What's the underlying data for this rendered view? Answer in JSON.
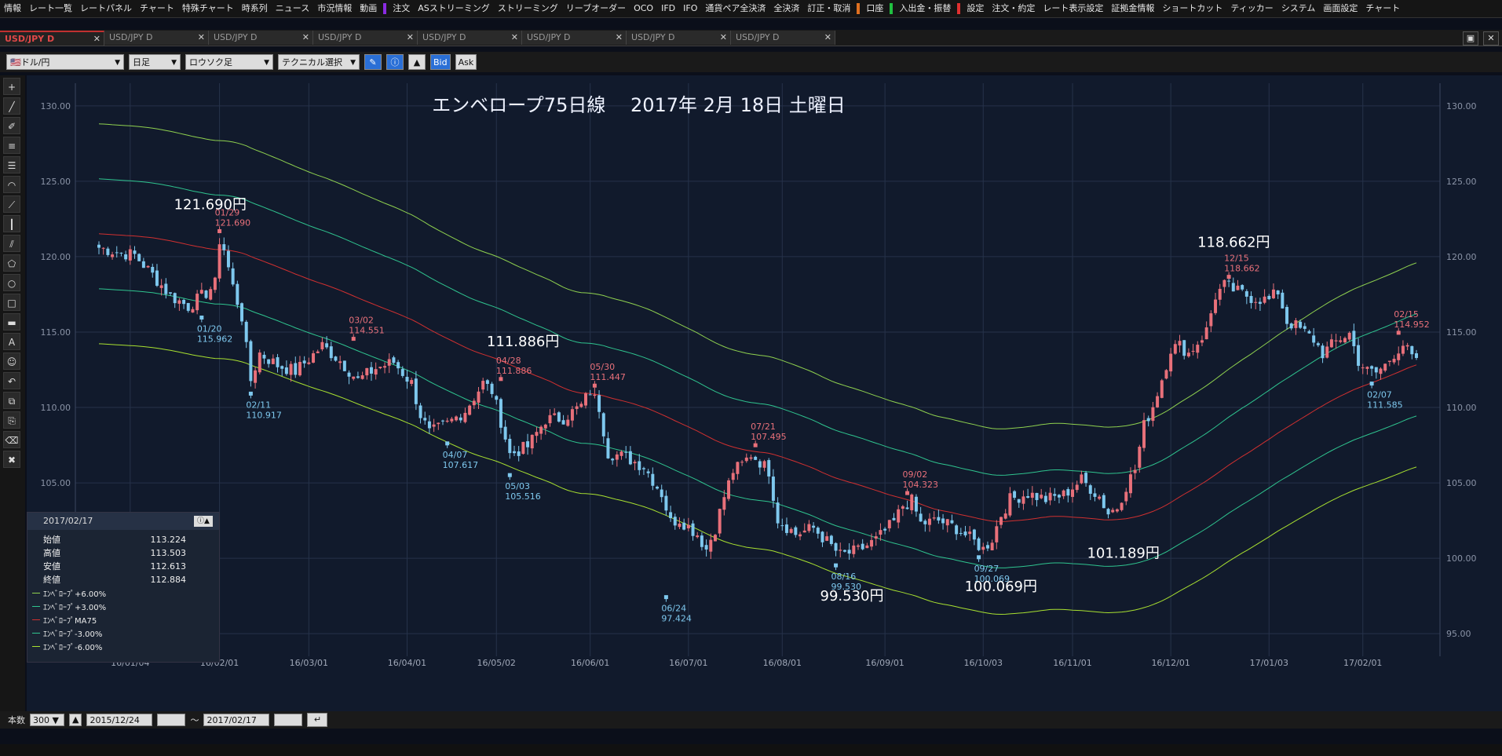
{
  "menubar": {
    "items": [
      "情報",
      "レート一覧",
      "レートパネル",
      "チャート",
      "特殊チャート",
      "時系列",
      "ニュース",
      "市況情報",
      "動画",
      "注文",
      "ASストリーミング",
      "ストリーミング",
      "リーブオーダー",
      "OCO",
      "IFD",
      "IFO",
      "通貨ペア全決済",
      "全決済",
      "訂正・取消",
      "口座",
      "入出金・振替",
      "設定",
      "注文・約定",
      "レート表示設定",
      "証拠金情報",
      "ショートカット",
      "ティッカー",
      "システム",
      "画面設定",
      "チャート"
    ]
  },
  "tabs": [
    "USD/JPY D",
    "USD/JPY D",
    "USD/JPY D",
    "USD/JPY D",
    "USD/JPY D",
    "USD/JPY D",
    "USD/JPY D",
    "USD/JPY D"
  ],
  "toolbar": {
    "pair": "ドル/円",
    "period": "日足",
    "style": "ロウソク足",
    "technical": "テクニカル選択",
    "bid": "Bid",
    "ask": "Ask"
  },
  "bottom": {
    "count_label": "本数",
    "count": "300",
    "from": "2015/12/24",
    "tilde": "〜",
    "to": "2017/02/17"
  },
  "info": {
    "date": "2017/02/17",
    "rows": [
      {
        "label": "始値",
        "value": "113.224"
      },
      {
        "label": "高値",
        "value": "113.503"
      },
      {
        "label": "安値",
        "value": "112.613"
      },
      {
        "label": "終値",
        "value": "112.884"
      }
    ],
    "legend": [
      {
        "label": "ｴﾝﾍﾞﾛｰﾌﾟ+6.00%",
        "color": "#8fd14f"
      },
      {
        "label": "ｴﾝﾍﾞﾛｰﾌﾟ+3.00%",
        "color": "#2fc48f"
      },
      {
        "label": "ｴﾝﾍﾞﾛｰﾌﾟMA75",
        "color": "#d03030"
      },
      {
        "label": "ｴﾝﾍﾞﾛｰﾌﾟ-3.00%",
        "color": "#2fc48f"
      },
      {
        "label": "ｴﾝﾍﾞﾛｰﾌﾟ-6.00%",
        "color": "#a8e030"
      }
    ]
  },
  "chart_data": {
    "type": "candlestick",
    "title": "エンベロープ75日線　 2017年 2月 18日 土曜日",
    "ylim": [
      93.5,
      131.5
    ],
    "yticks": [
      "95.00",
      "100.00",
      "105.00",
      "110.00",
      "115.00",
      "120.00",
      "125.00",
      "130.00"
    ],
    "xticks": [
      {
        "label": "16/01/04",
        "i": 7
      },
      {
        "label": "16/02/01",
        "i": 27
      },
      {
        "label": "16/03/01",
        "i": 47
      },
      {
        "label": "16/04/01",
        "i": 69
      },
      {
        "label": "16/05/02",
        "i": 89
      },
      {
        "label": "16/06/01",
        "i": 110
      },
      {
        "label": "16/07/01",
        "i": 132
      },
      {
        "label": "16/08/01",
        "i": 153
      },
      {
        "label": "16/09/01",
        "i": 176
      },
      {
        "label": "16/10/03",
        "i": 198
      },
      {
        "label": "16/11/01",
        "i": 218
      },
      {
        "label": "16/12/01",
        "i": 240
      },
      {
        "label": "17/01/03",
        "i": 262
      },
      {
        "label": "17/02/01",
        "i": 283
      }
    ],
    "n_bars": 296,
    "anchors": [
      [
        0,
        120.6
      ],
      [
        4,
        120.3
      ],
      [
        8,
        120.1
      ],
      [
        12,
        118.8
      ],
      [
        16,
        117.4
      ],
      [
        20,
        116.7
      ],
      [
        24,
        117.6
      ],
      [
        26,
        118.2
      ],
      [
        27,
        121.1
      ],
      [
        28,
        120.5
      ],
      [
        30,
        118.0
      ],
      [
        32,
        116.0
      ],
      [
        34,
        111.8
      ],
      [
        36,
        113.6
      ],
      [
        40,
        112.8
      ],
      [
        44,
        112.4
      ],
      [
        48,
        113.5
      ],
      [
        50,
        114.1
      ],
      [
        54,
        113.1
      ],
      [
        58,
        111.8
      ],
      [
        62,
        112.6
      ],
      [
        66,
        113.0
      ],
      [
        70,
        111.6
      ],
      [
        72,
        109.5
      ],
      [
        74,
        108.3
      ],
      [
        78,
        108.9
      ],
      [
        82,
        109.8
      ],
      [
        86,
        111.6
      ],
      [
        88,
        111.1
      ],
      [
        90,
        109.1
      ],
      [
        92,
        106.9
      ],
      [
        96,
        107.4
      ],
      [
        100,
        109.2
      ],
      [
        104,
        109.3
      ],
      [
        108,
        110.1
      ],
      [
        110,
        111.1
      ],
      [
        112,
        110.0
      ],
      [
        114,
        107.0
      ],
      [
        118,
        106.7
      ],
      [
        122,
        106.1
      ],
      [
        126,
        104.3
      ],
      [
        128,
        102.4
      ],
      [
        130,
        102.6
      ],
      [
        134,
        101.6
      ],
      [
        136,
        100.6
      ],
      [
        138,
        102.0
      ],
      [
        140,
        104.1
      ],
      [
        142,
        105.8
      ],
      [
        144,
        106.2
      ],
      [
        146,
        106.9
      ],
      [
        148,
        106.4
      ],
      [
        150,
        105.8
      ],
      [
        152,
        102.6
      ],
      [
        156,
        101.6
      ],
      [
        160,
        102.0
      ],
      [
        164,
        100.8
      ],
      [
        166,
        100.2
      ],
      [
        170,
        100.5
      ],
      [
        174,
        101.2
      ],
      [
        178,
        102.4
      ],
      [
        180,
        103.5
      ],
      [
        182,
        103.8
      ],
      [
        184,
        102.3
      ],
      [
        188,
        102.5
      ],
      [
        192,
        102.0
      ],
      [
        196,
        101.1
      ],
      [
        198,
        100.6
      ],
      [
        200,
        101.3
      ],
      [
        202,
        102.9
      ],
      [
        204,
        103.9
      ],
      [
        208,
        104.3
      ],
      [
        212,
        103.9
      ],
      [
        216,
        104.2
      ],
      [
        220,
        105.2
      ],
      [
        224,
        104.1
      ],
      [
        226,
        103.0
      ],
      [
        228,
        103.4
      ],
      [
        230,
        104.8
      ],
      [
        232,
        105.9
      ],
      [
        234,
        108.8
      ],
      [
        236,
        110.1
      ],
      [
        238,
        111.9
      ],
      [
        240,
        113.9
      ],
      [
        242,
        114.1
      ],
      [
        244,
        113.6
      ],
      [
        246,
        114.3
      ],
      [
        248,
        115.1
      ],
      [
        250,
        117.4
      ],
      [
        252,
        118.1
      ],
      [
        254,
        117.8
      ],
      [
        258,
        117.3
      ],
      [
        262,
        117.1
      ],
      [
        264,
        117.7
      ],
      [
        266,
        115.7
      ],
      [
        268,
        115.4
      ],
      [
        272,
        114.5
      ],
      [
        274,
        113.6
      ],
      [
        276,
        114.1
      ],
      [
        278,
        114.6
      ],
      [
        280,
        114.9
      ],
      [
        282,
        113.1
      ],
      [
        284,
        112.4
      ],
      [
        286,
        112.3
      ],
      [
        288,
        112.8
      ],
      [
        290,
        113.6
      ],
      [
        292,
        114.2
      ],
      [
        294,
        113.3
      ],
      [
        295,
        112.9
      ]
    ],
    "annotations": [
      {
        "i": 27,
        "date": "01/29",
        "price": "121.690",
        "y": 121.69,
        "pos": "high"
      },
      {
        "i": 23,
        "date": "01/20",
        "price": "115.962",
        "y": 115.962,
        "pos": "low"
      },
      {
        "i": 57,
        "date": "03/02",
        "price": "114.551",
        "y": 114.551,
        "pos": "high"
      },
      {
        "i": 34,
        "date": "02/11",
        "price": "110.917",
        "y": 110.917,
        "pos": "low"
      },
      {
        "i": 90,
        "date": "04/28",
        "price": "111.886",
        "y": 111.886,
        "pos": "high"
      },
      {
        "i": 78,
        "date": "04/07",
        "price": "107.617",
        "y": 107.617,
        "pos": "low"
      },
      {
        "i": 111,
        "date": "05/30",
        "price": "111.447",
        "y": 111.447,
        "pos": "high"
      },
      {
        "i": 92,
        "date": "05/03",
        "price": "105.516",
        "y": 105.516,
        "pos": "low"
      },
      {
        "i": 127,
        "date": "06/24",
        "price": "97.424",
        "y": 97.424,
        "pos": "low"
      },
      {
        "i": 147,
        "date": "07/21",
        "price": "107.495",
        "y": 107.495,
        "pos": "high"
      },
      {
        "i": 165,
        "date": "08/16",
        "price": "99.530",
        "y": 99.53,
        "pos": "low"
      },
      {
        "i": 181,
        "date": "09/02",
        "price": "104.323",
        "y": 104.323,
        "pos": "high"
      },
      {
        "i": 197,
        "date": "09/27",
        "price": "100.069",
        "y": 100.069,
        "pos": "low"
      },
      {
        "i": 253,
        "date": "12/15",
        "price": "118.662",
        "y": 118.662,
        "pos": "high"
      },
      {
        "i": 291,
        "date": "02/15",
        "price": "114.952",
        "y": 114.952,
        "pos": "high"
      },
      {
        "i": 285,
        "date": "02/07",
        "price": "111.585",
        "y": 111.585,
        "pos": "low"
      }
    ],
    "callouts": [
      {
        "text": "121.690円",
        "i": 27,
        "y": 121.69,
        "dx": -58,
        "dy": -28
      },
      {
        "text": "111.886円",
        "i": 90,
        "y": 111.886,
        "dx": -18,
        "dy": -42
      },
      {
        "text": "118.662円",
        "i": 253,
        "y": 118.662,
        "dx": -40,
        "dy": -38
      },
      {
        "text": "99.530円",
        "i": 165,
        "y": 99.53,
        "dx": -20,
        "dy": 45
      },
      {
        "text": "100.069円",
        "i": 197,
        "y": 100.069,
        "dx": -18,
        "dy": 43
      },
      {
        "text": "101.189円",
        "i": 223,
        "y": 101.189,
        "dx": -10,
        "dy": 22
      }
    ]
  }
}
